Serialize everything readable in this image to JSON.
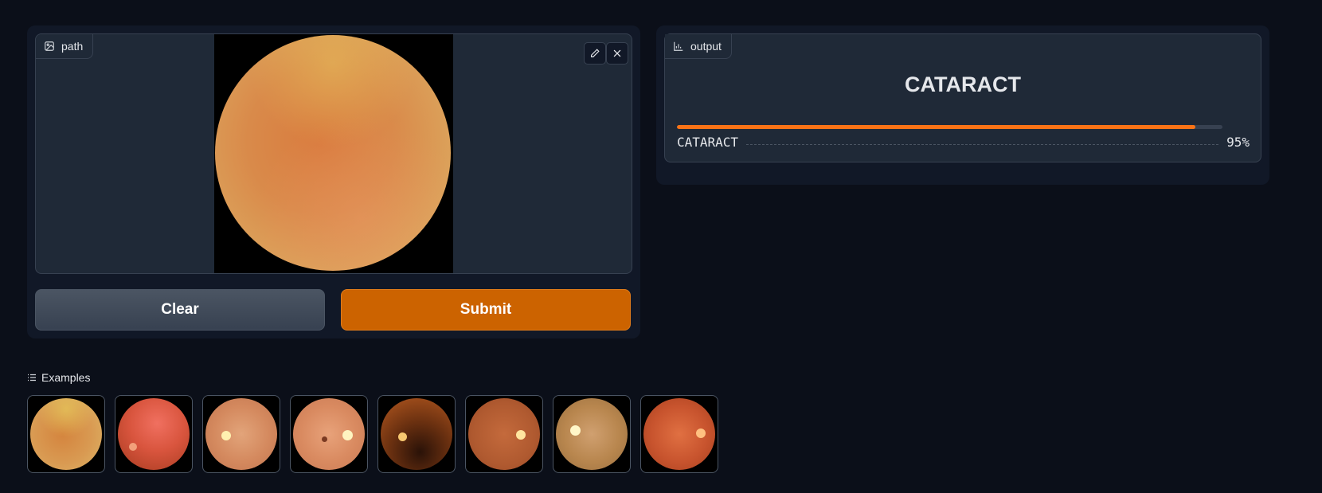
{
  "input": {
    "label": "path",
    "label_icon": "image-icon",
    "edit_icon": "pencil-icon",
    "close_icon": "close-icon"
  },
  "buttons": {
    "clear": "Clear",
    "submit": "Submit",
    "submit_color": "#cc6300"
  },
  "output": {
    "label": "output",
    "label_icon": "bar-chart-icon",
    "prediction": "CATARACT",
    "confidences": [
      {
        "label": "CATARACT",
        "value": "95%",
        "fraction": 0.95
      }
    ],
    "bar_color": "#f97316"
  },
  "examples": {
    "label": "Examples",
    "label_icon": "list-icon",
    "count": 8
  }
}
